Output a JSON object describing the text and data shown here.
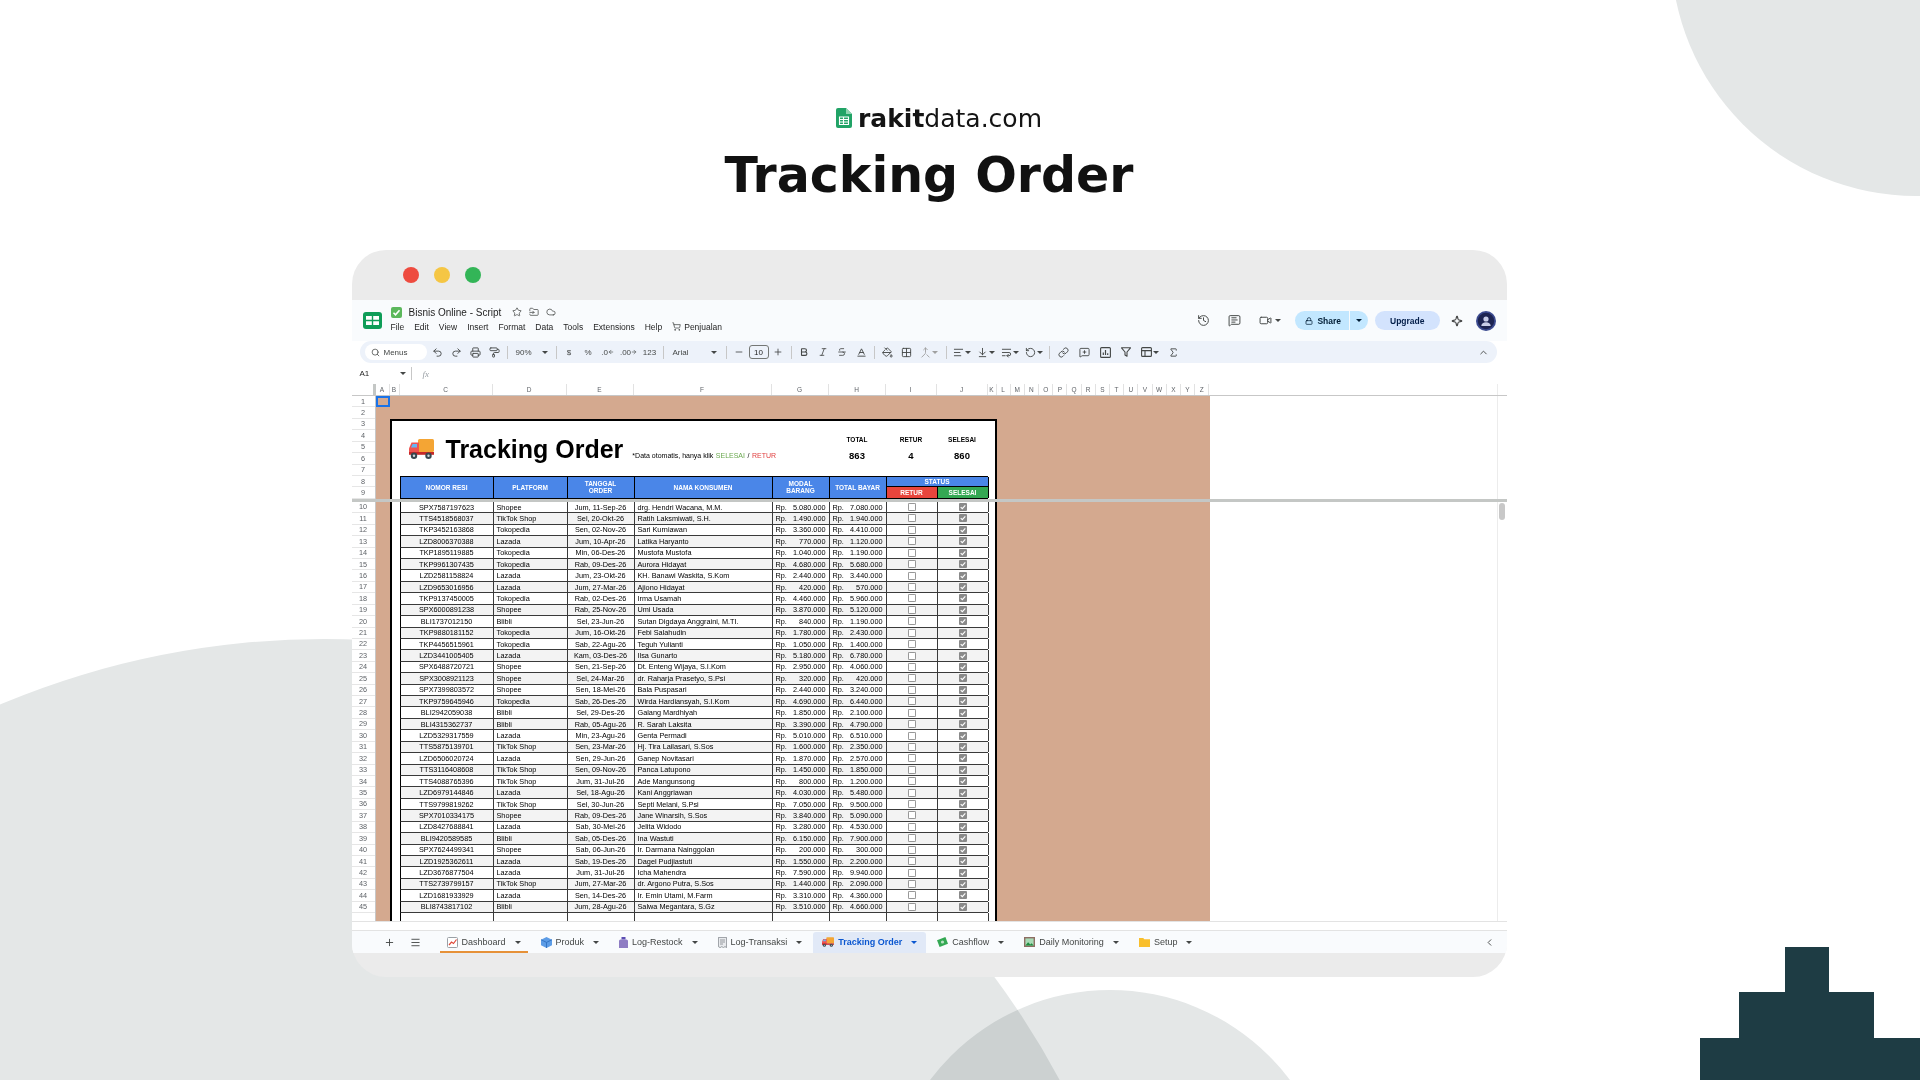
{
  "brand": "**rakit**data.com",
  "headline": "Tracking Order",
  "app": {
    "title": "Bisnis Online - Script",
    "menu": [
      {
        "label": "File",
        "kind": "menu"
      },
      {
        "label": "Edit",
        "kind": "menu"
      },
      {
        "label": "View",
        "kind": "menu"
      },
      {
        "label": "Insert",
        "kind": "menu"
      },
      {
        "label": "Format",
        "kind": "menu"
      },
      {
        "label": "Data",
        "kind": "menu"
      },
      {
        "label": "Tools",
        "kind": "menu"
      },
      {
        "label": "Extensions",
        "kind": "menu"
      },
      {
        "label": "Help",
        "kind": "menu"
      },
      {
        "label": "Penjualan",
        "kind": "custom"
      }
    ],
    "share": "Share",
    "upgrade": "Upgrade"
  },
  "toolbar": {
    "menu_search": "Menus",
    "zoom": "90%",
    "currency": "$",
    "percent": "%",
    "decimal_decrease": ".0",
    "decimal_increase": ".00",
    "number_format": "123",
    "font": "Arial",
    "font_size": "10"
  },
  "formula_bar": {
    "cell": "A1",
    "fx": "fx"
  },
  "grid": {
    "columns": [
      "A",
      "B",
      "C",
      "D",
      "E",
      "F",
      "G",
      "H",
      "I",
      "J",
      "K",
      "L",
      "M",
      "N",
      "O",
      "P",
      "Q",
      "R",
      "S",
      "T",
      "U",
      "V",
      "W",
      "X",
      "Y",
      "Z"
    ],
    "row_numbers": [
      "1",
      "2",
      "3",
      "4",
      "5",
      "6",
      "7",
      "8",
      "9",
      "10",
      "11",
      "12",
      "13",
      "14",
      "15",
      "16",
      "17",
      "18",
      "19",
      "20",
      "21",
      "22",
      "23",
      "24",
      "25",
      "26",
      "27",
      "28",
      "29",
      "30",
      "31",
      "32",
      "33",
      "34",
      "35",
      "36",
      "37",
      "38",
      "39",
      "40",
      "41",
      "42",
      "43",
      "44",
      "45"
    ]
  },
  "tracker": {
    "title": "Tracking Order",
    "note": [
      {
        "text": "*Data otomatis, hanya klik",
        "kind": "plain"
      },
      {
        "text": "SELESAI",
        "kind": "selesai"
      },
      {
        "text": "/",
        "kind": "plain"
      },
      {
        "text": "RETUR",
        "kind": "retur"
      }
    ],
    "stats": [
      {
        "label": "TOTAL",
        "value": "863"
      },
      {
        "label": "RETUR",
        "value": "4"
      },
      {
        "label": "SELESAI",
        "value": "860"
      }
    ],
    "columns": [
      "NOMOR RESI",
      "PLATFORM",
      "TANGGAL\nORDER",
      "NAMA KONSUMEN",
      "MODAL\nBARANG",
      "TOTAL BAYAR"
    ],
    "status": {
      "label": "STATUS",
      "options": [
        {
          "label": "RETUR",
          "color": "#e8453c"
        },
        {
          "label": "SELESAI",
          "color": "#34a853"
        }
      ]
    },
    "rows": [
      {
        "resi": "SPX7587197623",
        "platform": "Shopee",
        "date": "Jum, 11-Sep-26",
        "name": "drg. Hendri Wacana, M.M.",
        "modal": {
          "currency": "Rp.",
          "amount": "5.080.000"
        },
        "total": {
          "currency": "Rp.",
          "amount": "7.080.000"
        },
        "retur": false,
        "selesai": true
      },
      {
        "resi": "TTS4518568037",
        "platform": "TikTok Shop",
        "date": "Sel, 20-Okt-26",
        "name": "Ratih Laksmiwati, S.H.",
        "modal": {
          "currency": "Rp.",
          "amount": "1.490.000"
        },
        "total": {
          "currency": "Rp.",
          "amount": "1.940.000"
        },
        "retur": false,
        "selesai": true
      },
      {
        "resi": "TKP3452163868",
        "platform": "Tokopedia",
        "date": "Sen, 02-Nov-26",
        "name": "Sari Kurniawan",
        "modal": {
          "currency": "Rp.",
          "amount": "3.360.000"
        },
        "total": {
          "currency": "Rp.",
          "amount": "4.410.000"
        },
        "retur": false,
        "selesai": true
      },
      {
        "resi": "LZD8006370388",
        "platform": "Lazada",
        "date": "Jum, 10-Apr-26",
        "name": "Latika Haryanto",
        "modal": {
          "currency": "Rp.",
          "amount": "770.000"
        },
        "total": {
          "currency": "Rp.",
          "amount": "1.120.000"
        },
        "retur": false,
        "selesai": true
      },
      {
        "resi": "TKP1895119885",
        "platform": "Tokopedia",
        "date": "Min, 06-Des-26",
        "name": "Mustofa Mustofa",
        "modal": {
          "currency": "Rp.",
          "amount": "1.040.000"
        },
        "total": {
          "currency": "Rp.",
          "amount": "1.190.000"
        },
        "retur": false,
        "selesai": true
      },
      {
        "resi": "TKP9961307435",
        "platform": "Tokopedia",
        "date": "Rab, 09-Des-26",
        "name": "Aurora Hidayat",
        "modal": {
          "currency": "Rp.",
          "amount": "4.680.000"
        },
        "total": {
          "currency": "Rp.",
          "amount": "5.680.000"
        },
        "retur": false,
        "selesai": true
      },
      {
        "resi": "LZD2581158824",
        "platform": "Lazada",
        "date": "Jum, 23-Okt-26",
        "name": "KH. Banawi Waskita, S.Kom",
        "modal": {
          "currency": "Rp.",
          "amount": "2.440.000"
        },
        "total": {
          "currency": "Rp.",
          "amount": "3.440.000"
        },
        "retur": false,
        "selesai": true
      },
      {
        "resi": "LZD9653016956",
        "platform": "Lazada",
        "date": "Jum, 27-Mar-26",
        "name": "Ajiono Hidayat",
        "modal": {
          "currency": "Rp.",
          "amount": "420.000"
        },
        "total": {
          "currency": "Rp.",
          "amount": "570.000"
        },
        "retur": false,
        "selesai": true
      },
      {
        "resi": "TKP9137450005",
        "platform": "Tokopedia",
        "date": "Rab, 02-Des-26",
        "name": "Irma Usamah",
        "modal": {
          "currency": "Rp.",
          "amount": "4.460.000"
        },
        "total": {
          "currency": "Rp.",
          "amount": "5.960.000"
        },
        "retur": false,
        "selesai": true
      },
      {
        "resi": "SPX6000891238",
        "platform": "Shopee",
        "date": "Rab, 25-Nov-26",
        "name": "Umi Usada",
        "modal": {
          "currency": "Rp.",
          "amount": "3.870.000"
        },
        "total": {
          "currency": "Rp.",
          "amount": "5.120.000"
        },
        "retur": false,
        "selesai": true
      },
      {
        "resi": "BLI1737012150",
        "platform": "Blibli",
        "date": "Sel, 23-Jun-26",
        "name": "Sutan Digdaya Anggraini, M.TI.",
        "modal": {
          "currency": "Rp.",
          "amount": "840.000"
        },
        "total": {
          "currency": "Rp.",
          "amount": "1.190.000"
        },
        "retur": false,
        "selesai": true
      },
      {
        "resi": "TKP9880181152",
        "platform": "Tokopedia",
        "date": "Jum, 16-Okt-26",
        "name": "Febi Salahudin",
        "modal": {
          "currency": "Rp.",
          "amount": "1.780.000"
        },
        "total": {
          "currency": "Rp.",
          "amount": "2.430.000"
        },
        "retur": false,
        "selesai": true
      },
      {
        "resi": "TKP4456515961",
        "platform": "Tokopedia",
        "date": "Sab, 22-Agu-26",
        "name": "Teguh Yulianti",
        "modal": {
          "currency": "Rp.",
          "amount": "1.050.000"
        },
        "total": {
          "currency": "Rp.",
          "amount": "1.400.000"
        },
        "retur": false,
        "selesai": true
      },
      {
        "resi": "LZD3441005405",
        "platform": "Lazada",
        "date": "Kam, 03-Des-26",
        "name": "Ilsa Gunarto",
        "modal": {
          "currency": "Rp.",
          "amount": "5.180.000"
        },
        "total": {
          "currency": "Rp.",
          "amount": "6.780.000"
        },
        "retur": false,
        "selesai": true
      },
      {
        "resi": "SPX6488720721",
        "platform": "Shopee",
        "date": "Sen, 21-Sep-26",
        "name": "Dt. Enteng Wijaya, S.I.Kom",
        "modal": {
          "currency": "Rp.",
          "amount": "2.950.000"
        },
        "total": {
          "currency": "Rp.",
          "amount": "4.060.000"
        },
        "retur": false,
        "selesai": true
      },
      {
        "resi": "SPX3008921123",
        "platform": "Shopee",
        "date": "Sel, 24-Mar-26",
        "name": "dr. Raharja Prasetyo, S.Psi",
        "modal": {
          "currency": "Rp.",
          "amount": "320.000"
        },
        "total": {
          "currency": "Rp.",
          "amount": "420.000"
        },
        "retur": false,
        "selesai": true
      },
      {
        "resi": "SPX7399803572",
        "platform": "Shopee",
        "date": "Sen, 18-Mei-26",
        "name": "Bala Puspasari",
        "modal": {
          "currency": "Rp.",
          "amount": "2.440.000"
        },
        "total": {
          "currency": "Rp.",
          "amount": "3.240.000"
        },
        "retur": false,
        "selesai": true
      },
      {
        "resi": "TKP9759645946",
        "platform": "Tokopedia",
        "date": "Sab, 26-Des-26",
        "name": "Wirda Hardiansyah, S.I.Kom",
        "modal": {
          "currency": "Rp.",
          "amount": "4.690.000"
        },
        "total": {
          "currency": "Rp.",
          "amount": "6.440.000"
        },
        "retur": false,
        "selesai": true
      },
      {
        "resi": "BLI2942059038",
        "platform": "Blibli",
        "date": "Sel, 29-Des-26",
        "name": "Galang Mardhiyah",
        "modal": {
          "currency": "Rp.",
          "amount": "1.850.000"
        },
        "total": {
          "currency": "Rp.",
          "amount": "2.100.000"
        },
        "retur": false,
        "selesai": true
      },
      {
        "resi": "BLI4315362737",
        "platform": "Blibli",
        "date": "Rab, 05-Agu-26",
        "name": "R. Sarah Laksita",
        "modal": {
          "currency": "Rp.",
          "amount": "3.390.000"
        },
        "total": {
          "currency": "Rp.",
          "amount": "4.790.000"
        },
        "retur": false,
        "selesai": true
      },
      {
        "resi": "LZD5329317559",
        "platform": "Lazada",
        "date": "Min, 23-Agu-26",
        "name": "Genta Permadi",
        "modal": {
          "currency": "Rp.",
          "amount": "5.010.000"
        },
        "total": {
          "currency": "Rp.",
          "amount": "6.510.000"
        },
        "retur": false,
        "selesai": true
      },
      {
        "resi": "TTS5875139701",
        "platform": "TikTok Shop",
        "date": "Sen, 23-Mar-26",
        "name": "Hj. Tira Lailasari, S.Sos",
        "modal": {
          "currency": "Rp.",
          "amount": "1.600.000"
        },
        "total": {
          "currency": "Rp.",
          "amount": "2.350.000"
        },
        "retur": false,
        "selesai": true
      },
      {
        "resi": "LZD6506020724",
        "platform": "Lazada",
        "date": "Sen, 29-Jun-26",
        "name": "Ganep Novitasari",
        "modal": {
          "currency": "Rp.",
          "amount": "1.870.000"
        },
        "total": {
          "currency": "Rp.",
          "amount": "2.570.000"
        },
        "retur": false,
        "selesai": true
      },
      {
        "resi": "TTS3116408608",
        "platform": "TikTok Shop",
        "date": "Sen, 09-Nov-26",
        "name": "Panca Latupono",
        "modal": {
          "currency": "Rp.",
          "amount": "1.450.000"
        },
        "total": {
          "currency": "Rp.",
          "amount": "1.850.000"
        },
        "retur": false,
        "selesai": true
      },
      {
        "resi": "TTS4088765396",
        "platform": "TikTok Shop",
        "date": "Jum, 31-Jul-26",
        "name": "Ade Mangunsong",
        "modal": {
          "currency": "Rp.",
          "amount": "800.000"
        },
        "total": {
          "currency": "Rp.",
          "amount": "1.200.000"
        },
        "retur": false,
        "selesai": true
      },
      {
        "resi": "LZD6979144846",
        "platform": "Lazada",
        "date": "Sel, 18-Agu-26",
        "name": "Kani Anggriawan",
        "modal": {
          "currency": "Rp.",
          "amount": "4.030.000"
        },
        "total": {
          "currency": "Rp.",
          "amount": "5.480.000"
        },
        "retur": false,
        "selesai": true
      },
      {
        "resi": "TTS9799819262",
        "platform": "TikTok Shop",
        "date": "Sel, 30-Jun-26",
        "name": "Septi Melani, S.Psi",
        "modal": {
          "currency": "Rp.",
          "amount": "7.050.000"
        },
        "total": {
          "currency": "Rp.",
          "amount": "9.500.000"
        },
        "retur": false,
        "selesai": true
      },
      {
        "resi": "SPX7010334175",
        "platform": "Shopee",
        "date": "Rab, 09-Des-26",
        "name": "Jane Winarsih, S.Sos",
        "modal": {
          "currency": "Rp.",
          "amount": "3.840.000"
        },
        "total": {
          "currency": "Rp.",
          "amount": "5.090.000"
        },
        "retur": false,
        "selesai": true
      },
      {
        "resi": "LZD8427688841",
        "platform": "Lazada",
        "date": "Sab, 30-Mei-26",
        "name": "Jelita Widodo",
        "modal": {
          "currency": "Rp.",
          "amount": "3.280.000"
        },
        "total": {
          "currency": "Rp.",
          "amount": "4.530.000"
        },
        "retur": false,
        "selesai": true
      },
      {
        "resi": "BLI9420589585",
        "platform": "Blibli",
        "date": "Sab, 05-Des-26",
        "name": "Ina Wastuti",
        "modal": {
          "currency": "Rp.",
          "amount": "6.150.000"
        },
        "total": {
          "currency": "Rp.",
          "amount": "7.900.000"
        },
        "retur": false,
        "selesai": true
      },
      {
        "resi": "SPX7624499341",
        "platform": "Shopee",
        "date": "Sab, 06-Jun-26",
        "name": "Ir. Darmana Nainggolan",
        "modal": {
          "currency": "Rp.",
          "amount": "200.000"
        },
        "total": {
          "currency": "Rp.",
          "amount": "300.000"
        },
        "retur": false,
        "selesai": true
      },
      {
        "resi": "LZD1925362611",
        "platform": "Lazada",
        "date": "Sab, 19-Des-26",
        "name": "Dagel Pudjiastuti",
        "modal": {
          "currency": "Rp.",
          "amount": "1.550.000"
        },
        "total": {
          "currency": "Rp.",
          "amount": "2.200.000"
        },
        "retur": false,
        "selesai": true
      },
      {
        "resi": "LZD3676877504",
        "platform": "Lazada",
        "date": "Jum, 31-Jul-26",
        "name": "Icha Mahendra",
        "modal": {
          "currency": "Rp.",
          "amount": "7.590.000"
        },
        "total": {
          "currency": "Rp.",
          "amount": "9.940.000"
        },
        "retur": false,
        "selesai": true
      },
      {
        "resi": "TTS2739799157",
        "platform": "TikTok Shop",
        "date": "Jum, 27-Mar-26",
        "name": "dr. Argono Putra, S.Sos",
        "modal": {
          "currency": "Rp.",
          "amount": "1.440.000"
        },
        "total": {
          "currency": "Rp.",
          "amount": "2.090.000"
        },
        "retur": false,
        "selesai": true
      },
      {
        "resi": "LZD1681933929",
        "platform": "Lazada",
        "date": "Sen, 14-Des-26",
        "name": "Ir. Emin Utami, M.Farm",
        "modal": {
          "currency": "Rp.",
          "amount": "3.310.000"
        },
        "total": {
          "currency": "Rp.",
          "amount": "4.360.000"
        },
        "retur": false,
        "selesai": true
      },
      {
        "resi": "BLI8743817102",
        "platform": "Blibli",
        "date": "Jum, 28-Agu-26",
        "name": "Salwa Megantara, S.Gz",
        "modal": {
          "currency": "Rp.",
          "amount": "3.510.000"
        },
        "total": {
          "currency": "Rp.",
          "amount": "4.660.000"
        },
        "retur": false,
        "selesai": true
      }
    ]
  },
  "sheet_tabs": [
    {
      "label": "Dashboard",
      "selected": false,
      "color": "#e69138"
    },
    {
      "label": "Produk",
      "selected": false
    },
    {
      "label": "Log-Restock",
      "selected": false
    },
    {
      "label": "Log-Transaksi",
      "selected": false
    },
    {
      "label": "Tracking Order",
      "selected": true
    },
    {
      "label": "Cashflow",
      "selected": false
    },
    {
      "label": "Daily Monitoring",
      "selected": false
    },
    {
      "label": "Setup",
      "selected": false
    }
  ]
}
